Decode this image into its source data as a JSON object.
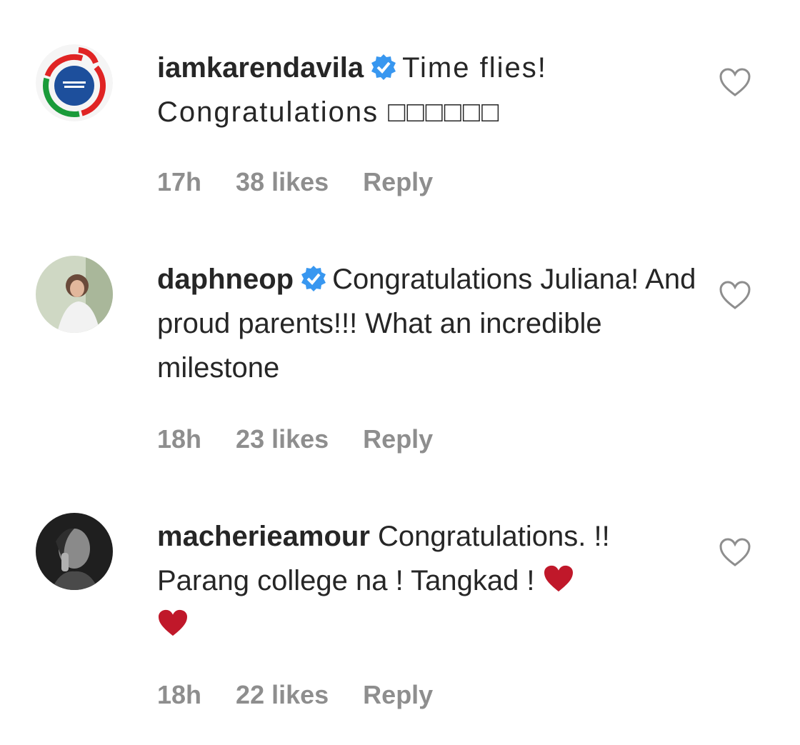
{
  "comments": [
    {
      "username": "iamkarendavila",
      "verified": true,
      "text": "Time flies! Congratulations □□□□□□",
      "time": "17h",
      "likes": "38 likes",
      "reply": "Reply"
    },
    {
      "username": "daphneop",
      "verified": true,
      "text": "Congratulations Juliana! And proud parents!!! What an incredible milestone",
      "time": "18h",
      "likes": "23 likes",
      "reply": "Reply"
    },
    {
      "username": "macherieamour",
      "verified": false,
      "text": "Congratulations. !! Parang college na ! Tangkad !",
      "time": "18h",
      "likes": "22 likes",
      "reply": "Reply"
    }
  ],
  "colors": {
    "text": "#262626",
    "meta": "#8e8e8e",
    "verified": "#3897f0",
    "heart_emoji": "#c0182a"
  },
  "icons": {
    "verified": "verified-badge-icon",
    "like": "heart-outline-icon",
    "emoji": "red-heart-emoji"
  }
}
